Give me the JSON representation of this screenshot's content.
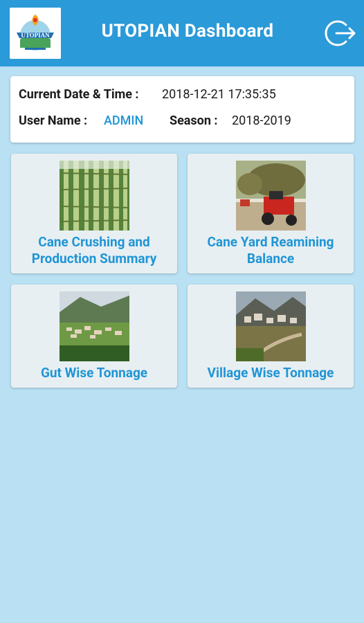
{
  "header": {
    "title": "UTOPIAN Dashboard",
    "logo_text": "UTOPIAN",
    "logout_icon": "logout-icon"
  },
  "info": {
    "datetime_label": "Current Date & Time :",
    "datetime_value": "2018-12-21 17:35:35",
    "user_label": "User Name :",
    "user_value": "ADMIN",
    "season_label": "Season :",
    "season_value": "2018-2019"
  },
  "tiles": [
    {
      "label": "Cane Crushing and Production Summary",
      "icon": "sugarcane-image"
    },
    {
      "label": "Cane Yard Reamining Balance",
      "icon": "tractor-image"
    },
    {
      "label": "Gut Wise Tonnage",
      "icon": "hillside-town-image"
    },
    {
      "label": "Village Wise Tonnage",
      "icon": "mountain-village-image"
    }
  ],
  "colors": {
    "appbar": "#2a9ad8",
    "background": "#b9e0f3",
    "accent_text": "#1f95d6"
  }
}
